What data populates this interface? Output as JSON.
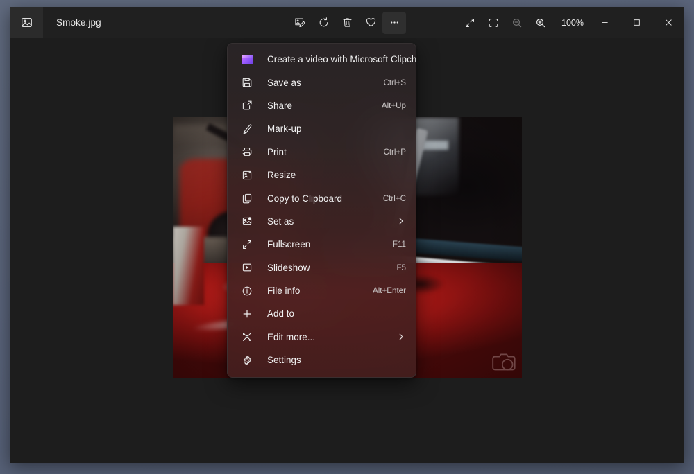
{
  "window": {
    "app_icon": "photo-icon",
    "file_title": "Smoke.jpg"
  },
  "toolbar": {
    "buttons": [
      {
        "name": "edit-image-button",
        "icon": "image-edit-icon",
        "label": "Edit image",
        "active": false
      },
      {
        "name": "rotate-button",
        "icon": "rotate-icon",
        "label": "Rotate",
        "active": false
      },
      {
        "name": "delete-button",
        "icon": "trash-icon",
        "label": "Delete",
        "active": false
      },
      {
        "name": "favorite-button",
        "icon": "heart-icon",
        "label": "Add to favorites",
        "active": false
      },
      {
        "name": "more-options-button",
        "icon": "ellipsis-icon",
        "label": "See more",
        "active": true
      }
    ]
  },
  "view_controls": {
    "fullscreen_label": "Fullscreen",
    "fit_label": "Fit to window",
    "zoom_out_label": "Zoom out",
    "zoom_in_label": "Zoom in",
    "zoom_level": "100%"
  },
  "window_controls": {
    "minimize": "Minimize",
    "maximize": "Maximize",
    "close": "Close"
  },
  "context_menu": {
    "items": [
      {
        "icon": "clipchamp-icon",
        "label": "Create a video with Microsoft Clipchamp",
        "accel": "",
        "submenu": false
      },
      {
        "icon": "save-icon",
        "label": "Save as",
        "accel": "Ctrl+S",
        "submenu": false
      },
      {
        "icon": "share-icon",
        "label": "Share",
        "accel": "Alt+Up",
        "submenu": false
      },
      {
        "icon": "markup-pen-icon",
        "label": "Mark-up",
        "accel": "",
        "submenu": false
      },
      {
        "icon": "printer-icon",
        "label": "Print",
        "accel": "Ctrl+P",
        "submenu": false
      },
      {
        "icon": "resize-icon",
        "label": "Resize",
        "accel": "",
        "submenu": false
      },
      {
        "icon": "copy-icon",
        "label": "Copy to Clipboard",
        "accel": "Ctrl+C",
        "submenu": false
      },
      {
        "icon": "set-as-icon",
        "label": "Set as",
        "accel": "",
        "submenu": true
      },
      {
        "icon": "fullscreen-icon",
        "label": "Fullscreen",
        "accel": "F11",
        "submenu": false
      },
      {
        "icon": "slideshow-icon",
        "label": "Slideshow",
        "accel": "F5",
        "submenu": false
      },
      {
        "icon": "info-icon",
        "label": "File info",
        "accel": "Alt+Enter",
        "submenu": false
      },
      {
        "icon": "plus-icon",
        "label": "Add to",
        "accel": "",
        "submenu": false
      },
      {
        "icon": "edit-more-icon",
        "label": "Edit more...",
        "accel": "",
        "submenu": true
      },
      {
        "icon": "gear-icon",
        "label": "Settings",
        "accel": "",
        "submenu": false
      }
    ]
  },
  "photo": {
    "alt": "Classic red car hood and windshield inside a garage",
    "watermark": "camera-watermark"
  },
  "colors": {
    "desktop": "#5d6678",
    "window_bg": "#1d1d1d",
    "titlebar": "#202020",
    "accent_clipchamp": "#9b5cff",
    "menu_tint": "#2c2627",
    "car_red": "#c41f1c"
  }
}
